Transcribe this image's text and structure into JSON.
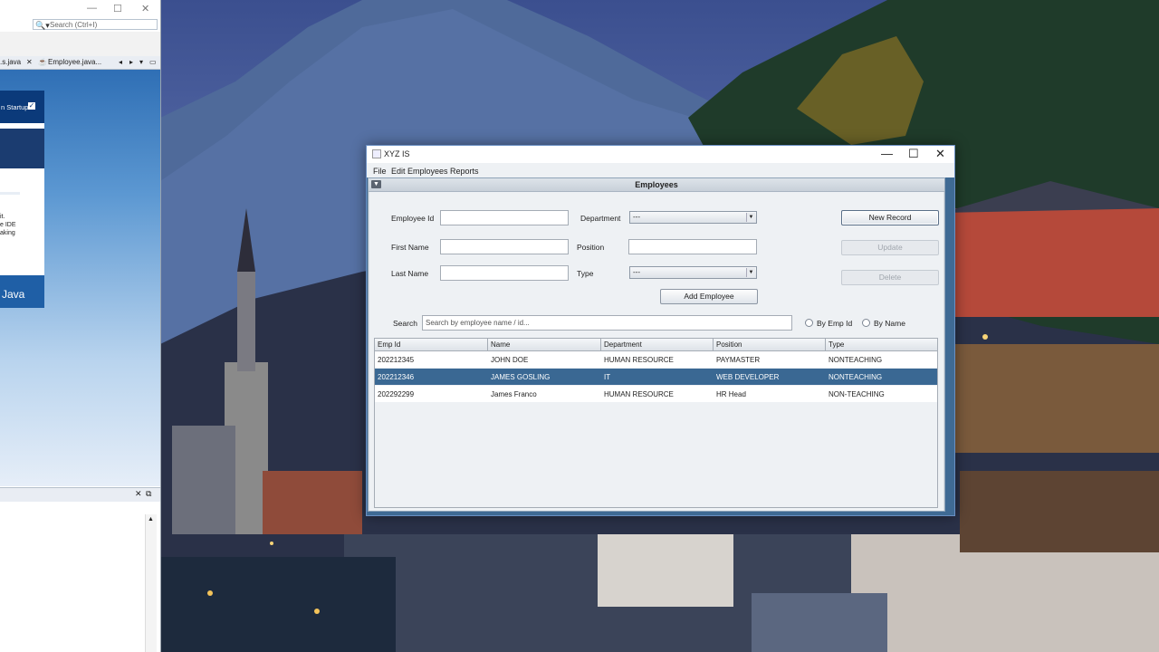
{
  "ide": {
    "search_placeholder": "Search (Ctrl+I)",
    "tabs": [
      ".s.java",
      "Employee.java..."
    ],
    "panel_top": "n Startup",
    "panel_text": [
      "it.",
      "e IDE",
      "aking"
    ],
    "panel_logo": "Java"
  },
  "app": {
    "window_title": "XYZ IS",
    "menu": [
      "File",
      "Edit",
      "Employees",
      "Reports"
    ],
    "internal_title": "Employees",
    "form": {
      "emp_id_label": "Employee Id",
      "first_name_label": "First Name",
      "last_name_label": "Last Name",
      "department_label": "Department",
      "position_label": "Position",
      "type_label": "Type",
      "department_value": "---",
      "type_value": "---",
      "add_button": "Add Employee"
    },
    "actions": {
      "new_record": "New Record",
      "update": "Update",
      "delete": "Delete"
    },
    "search": {
      "label": "Search",
      "placeholder": "Search by employee name / id...",
      "by_emp_id": "By Emp Id",
      "by_name": "By Name"
    },
    "table": {
      "columns": [
        "Emp Id",
        "Name",
        "Department",
        "Position",
        "Type"
      ],
      "rows": [
        [
          "202212345",
          "JOHN DOE",
          "HUMAN RESOURCE",
          "PAYMASTER",
          "NONTEACHING"
        ],
        [
          "202212346",
          "JAMES GOSLING",
          "IT",
          "WEB DEVELOPER",
          "NONTEACHING"
        ],
        [
          "202292299",
          "James Franco",
          "HUMAN RESOURCE",
          "HR Head",
          "NON-TEACHING"
        ]
      ],
      "selected_row_index": 1
    }
  },
  "colors": {
    "selection": "#3a6893",
    "frame": "#3f6a94"
  }
}
